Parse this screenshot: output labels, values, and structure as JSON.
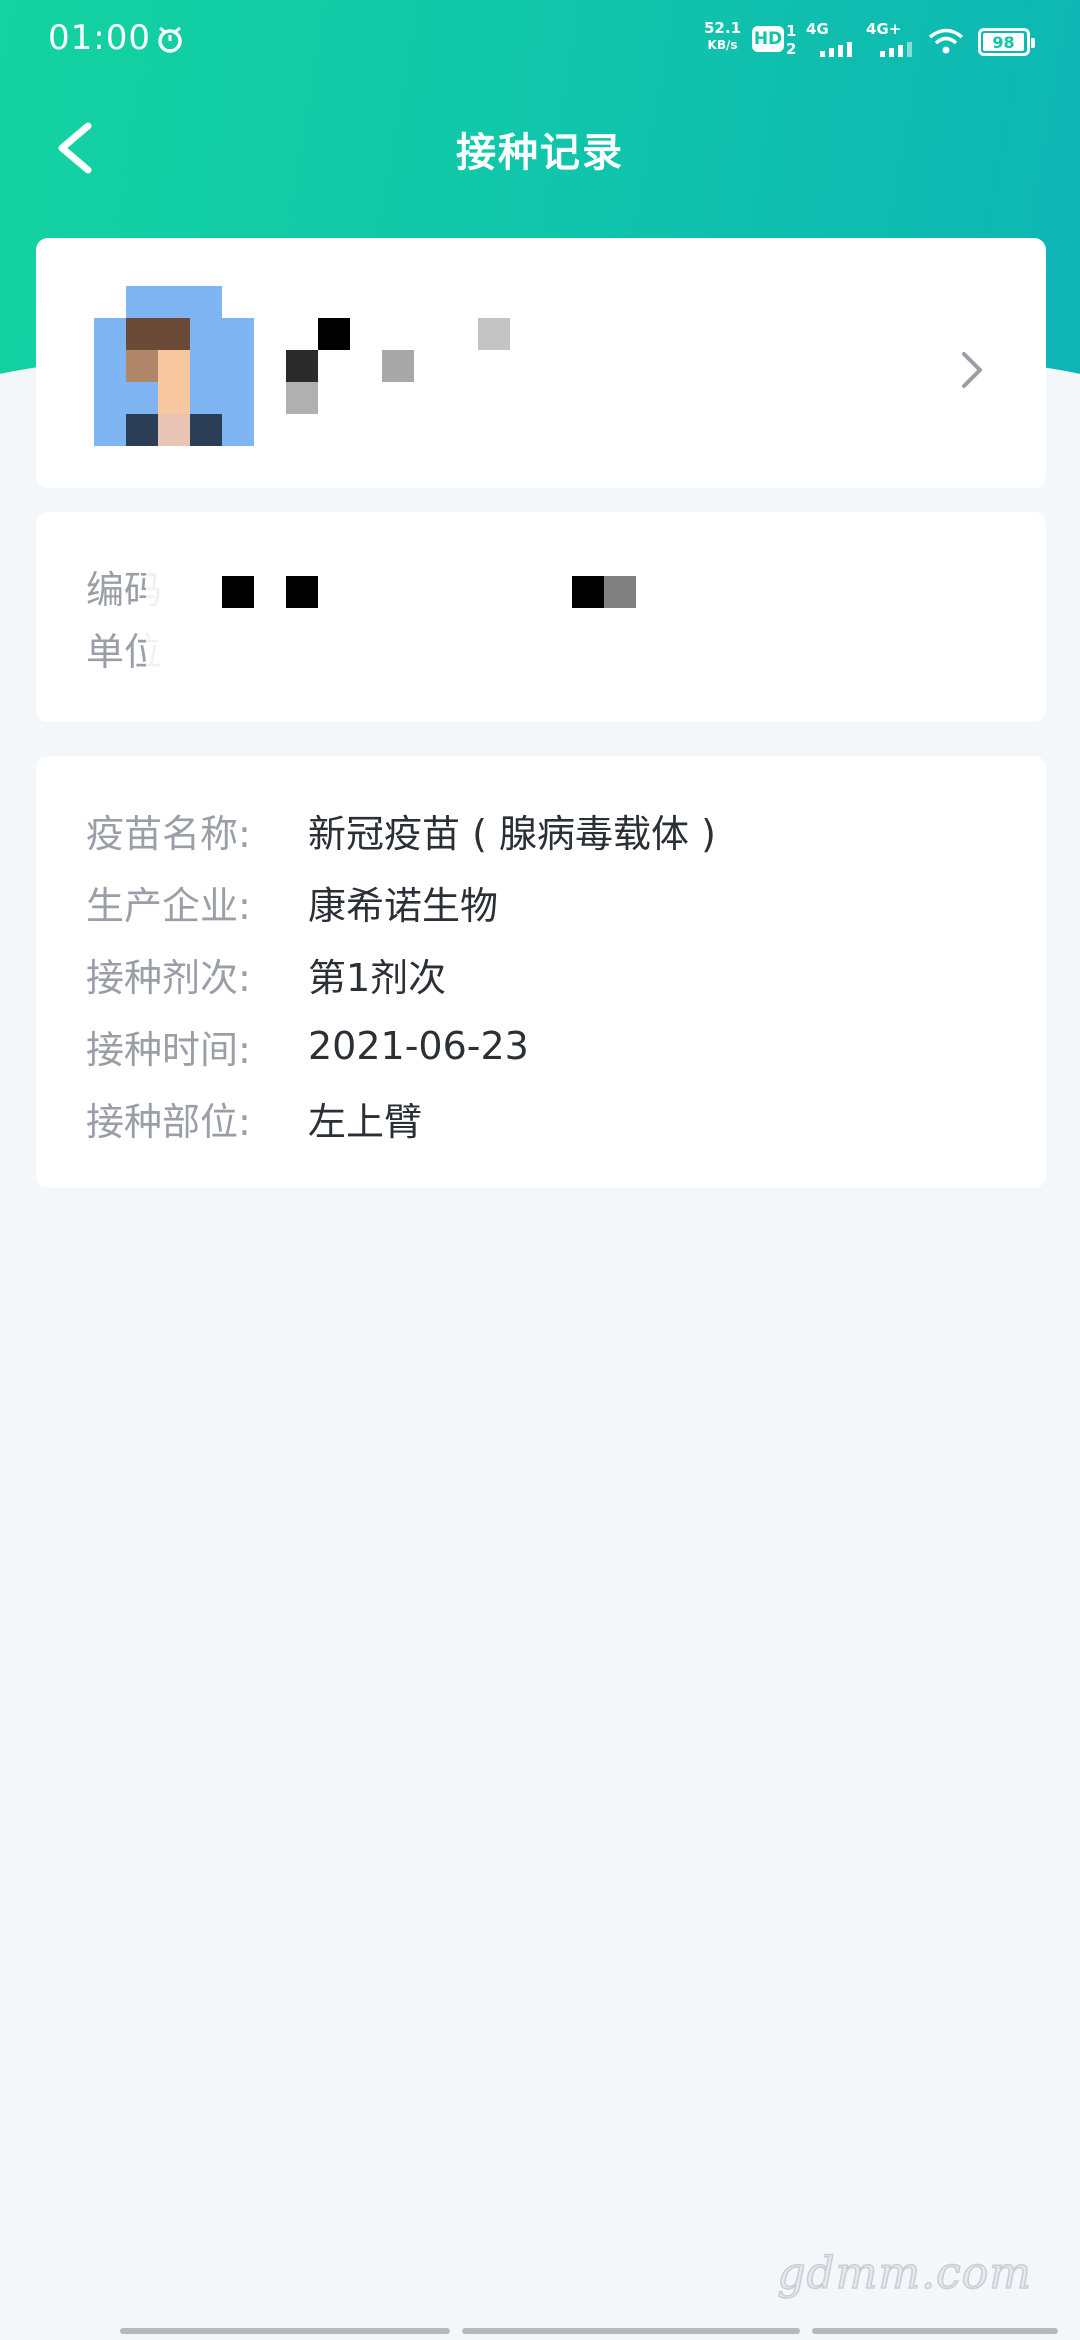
{
  "status_bar": {
    "time": "01:00",
    "net_speed_value": "52.1",
    "net_speed_unit": "KB/s",
    "hd_badge": "HD",
    "sim_numbers": [
      "1",
      "2"
    ],
    "signal1_label": "4G",
    "signal2_label": "4G+",
    "battery": "98",
    "icons": [
      "alarm-icon",
      "wifi-icon",
      "battery-icon"
    ]
  },
  "nav": {
    "title": "接种记录",
    "back_icon": "chevron-left-icon"
  },
  "profile": {
    "avatar_icon": "avatar-mosaic",
    "chevron_icon": "chevron-right-icon"
  },
  "info": {
    "code_label": "编码",
    "unit_label": "单位"
  },
  "vaccine_record": {
    "rows": [
      {
        "label": "疫苗名称:",
        "value": "新冠疫苗 ( 腺病毒载体 )"
      },
      {
        "label": "生产企业:",
        "value": "康希诺生物"
      },
      {
        "label": "接种剂次:",
        "value": "第1剂次"
      },
      {
        "label": "接种时间:",
        "value": "2021-06-23"
      },
      {
        "label": "接种部位:",
        "value": "左上臂"
      }
    ]
  },
  "watermark": "gdmm.com",
  "colors": {
    "header_start": "#13d3a0",
    "header_end": "#0db5b5",
    "background": "#f4f7fa",
    "label_gray": "#9a9ea6",
    "value_dark": "#2b2f36"
  }
}
